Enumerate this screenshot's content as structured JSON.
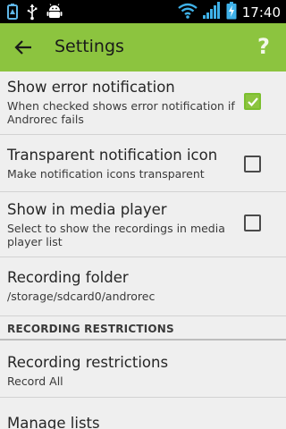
{
  "status_bar": {
    "time": "17:40",
    "left_icons": [
      "usb-storage-icon",
      "usb-icon",
      "android-debug-icon"
    ],
    "right_icons": [
      "wifi-icon",
      "signal-icon",
      "battery-charging-icon"
    ]
  },
  "action_bar": {
    "title": "Settings",
    "help_label": "?"
  },
  "settings": [
    {
      "title": "Show error notification",
      "summary": "When checked shows error notification if Androrec fails",
      "checkbox": true,
      "checked": true
    },
    {
      "title": "Transparent notification icon",
      "summary": "Make notification icons transparent",
      "checkbox": true,
      "checked": false
    },
    {
      "title": "Show in media player",
      "summary": "Select to show the recordings in media player list",
      "checkbox": true,
      "checked": false
    },
    {
      "title": "Recording folder",
      "summary": "/storage/sdcard0/androrec",
      "checkbox": false
    }
  ],
  "section_header": "RECORDING RESTRICTIONS",
  "restrictions": [
    {
      "title": "Recording restrictions",
      "summary": "Record All"
    },
    {
      "title": "Manage lists",
      "summary": ""
    }
  ],
  "colors": {
    "accent": "#8cc43f",
    "background": "#efefef",
    "status_bar": "#000000"
  }
}
